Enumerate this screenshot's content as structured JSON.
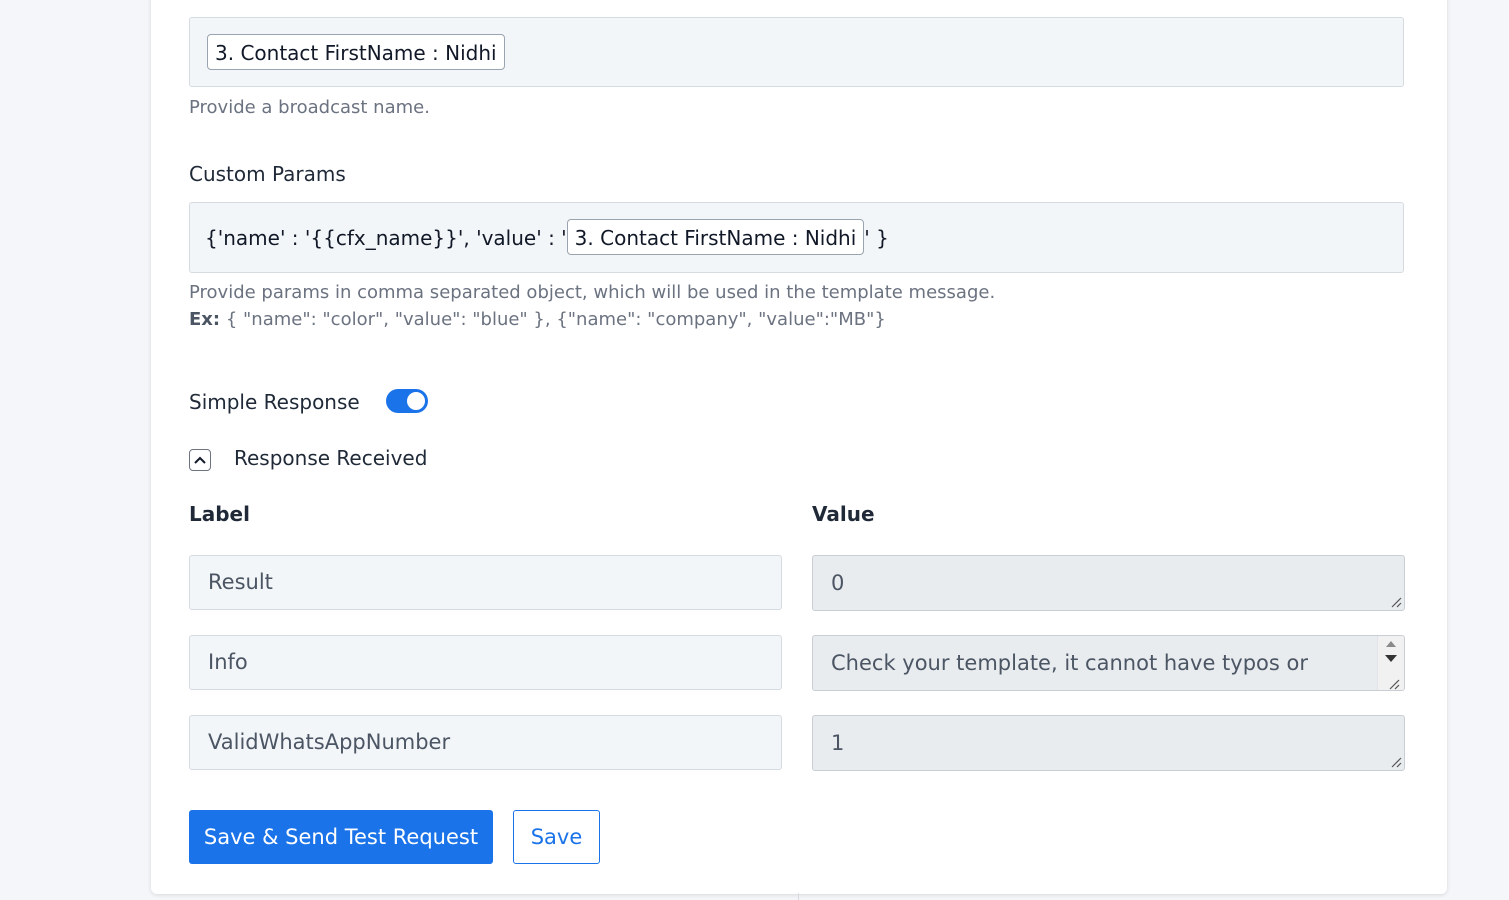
{
  "broadcast": {
    "chip": "3. Contact FirstName : Nidhi",
    "help": "Provide a broadcast name."
  },
  "custom_params": {
    "label": "Custom Params",
    "prefix": "{'name' : '{{cfx_name}}', 'value' : '",
    "chip": "3. Contact FirstName : Nidhi",
    "suffix": "' }",
    "help": "Provide params in comma separated object, which will be used in the template message.",
    "example_label": "Ex:",
    "example": " { \"name\": \"color\", \"value\": \"blue\" }, {\"name\": \"company\", \"value\":\"MB\"}"
  },
  "simple_response": {
    "label": "Simple Response",
    "enabled": true
  },
  "response_received": {
    "label": "Response Received"
  },
  "table": {
    "label_header": "Label",
    "value_header": "Value",
    "rows": [
      {
        "label": "Result",
        "value": "0"
      },
      {
        "label": "Info",
        "value": "Check your template, it cannot have typos or"
      },
      {
        "label": "ValidWhatsAppNumber",
        "value": "1"
      }
    ]
  },
  "buttons": {
    "send_test": "Save & Send Test Request",
    "save": "Save"
  },
  "colors": {
    "accent": "#1a73e8",
    "field_bg": "#f3f6f9",
    "readonly_bg": "#e9ecef"
  }
}
